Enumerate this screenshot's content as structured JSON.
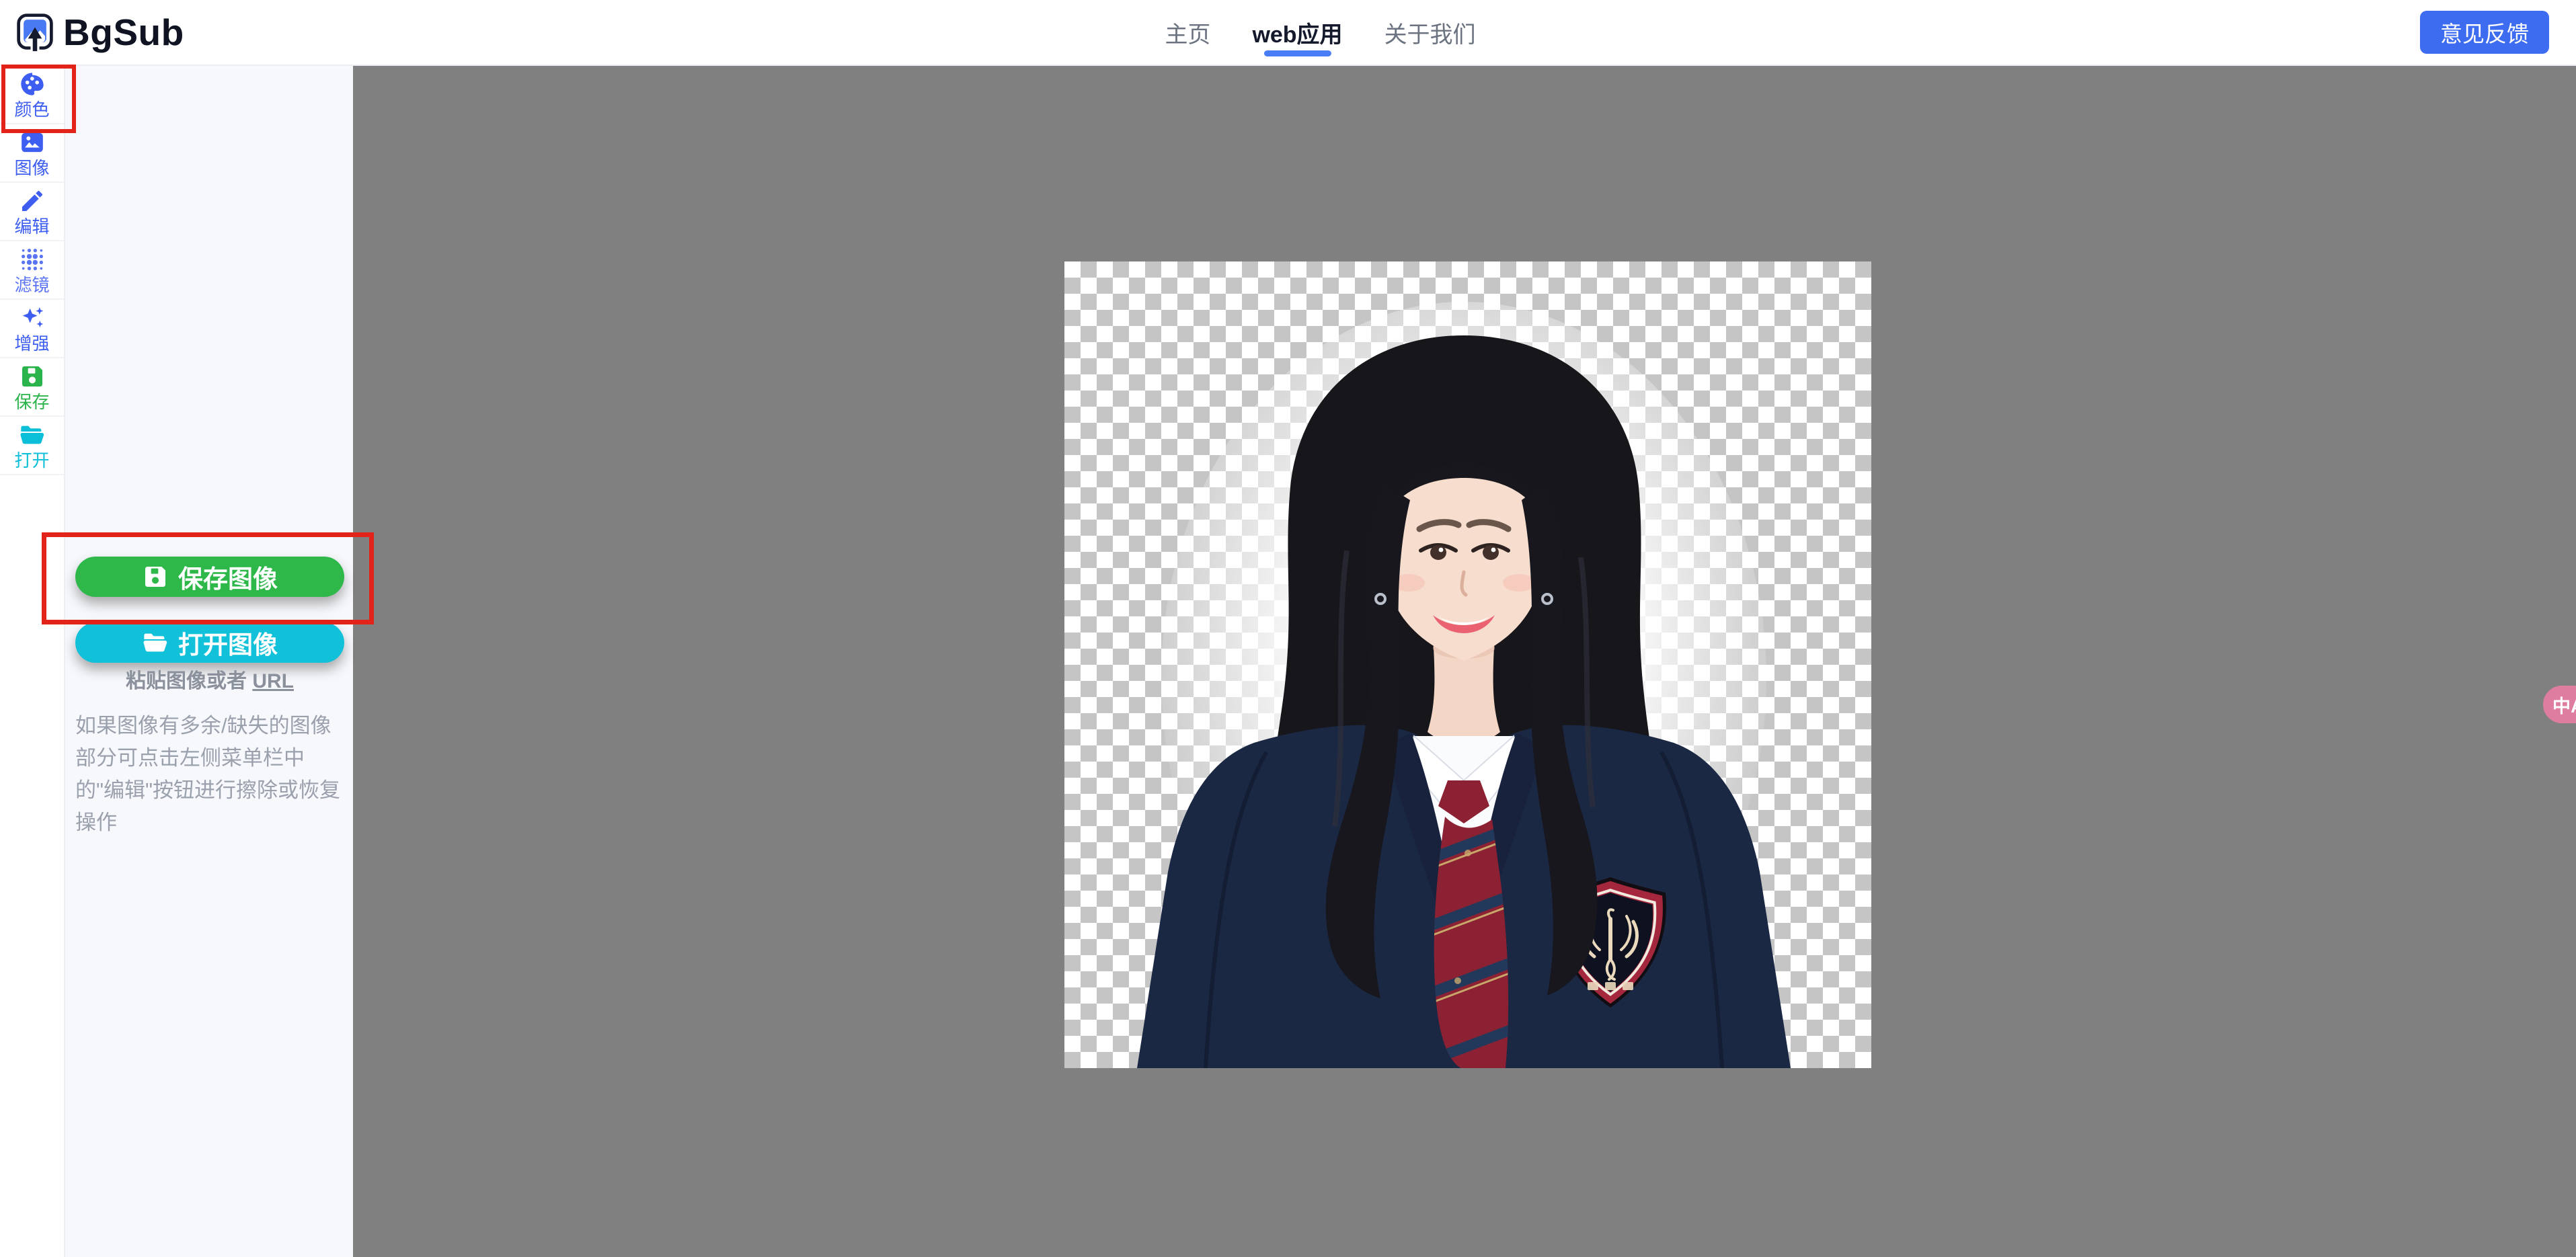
{
  "app_title": "BgSub",
  "header": {
    "logo_text": "BgSub",
    "nav_items": [
      {
        "label": "主页",
        "active": false
      },
      {
        "label": "web应用",
        "active": true
      },
      {
        "label": "关于我们",
        "active": false
      }
    ],
    "feedback_button_label": "意见反馈"
  },
  "sidebar": {
    "items": [
      {
        "label": "颜色",
        "icon": "palette-icon",
        "color": "#3d5ef1",
        "highlighted": true
      },
      {
        "label": "图像",
        "icon": "image-icon",
        "color": "#3d5ef1",
        "highlighted": false
      },
      {
        "label": "编辑",
        "icon": "pencil-icon",
        "color": "#3d5ef1",
        "highlighted": false
      },
      {
        "label": "滤镜",
        "icon": "halftone-dots-icon",
        "color": "#5b74f3",
        "highlighted": false
      },
      {
        "label": "增强",
        "icon": "sparkles-icon",
        "color": "#3d5ef1",
        "highlighted": false
      },
      {
        "label": "保存",
        "icon": "save-floppy-icon",
        "color": "#2cb44c",
        "highlighted": false
      },
      {
        "label": "打开",
        "icon": "folder-open-icon",
        "color": "#0bbfd8",
        "highlighted": false
      }
    ]
  },
  "panel": {
    "save_button_label": "保存图像",
    "open_button_label": "打开图像",
    "paste_hint_text": "粘贴图像或者 ",
    "paste_hint_link": "URL",
    "tip_text": "如果图像有多余/缺失的图像部分可点击左侧菜单栏中的\"编辑\"按钮进行擦除或恢复操作"
  },
  "canvas": {
    "subject": "cut-out portrait of a smiling young woman in a navy school blazer with maroon striped tie and phoenix crest badge on a transparent checkerboard background"
  },
  "floating": {
    "translate_button_glyph": "中A"
  },
  "theme": {
    "accent_blue": "#3e6cf0",
    "nav_underline_blue": "#4a7df5",
    "icon_blue": "#3d5ef1",
    "save_green": "#2eb84a",
    "open_cyan": "#10c1d9",
    "highlight_red": "#e2231a",
    "translate_pink": "#df7da0",
    "canvas_gray": "#808080",
    "checker_gray": "#c5c5c5",
    "panel_bg": "#f7f8fc"
  }
}
